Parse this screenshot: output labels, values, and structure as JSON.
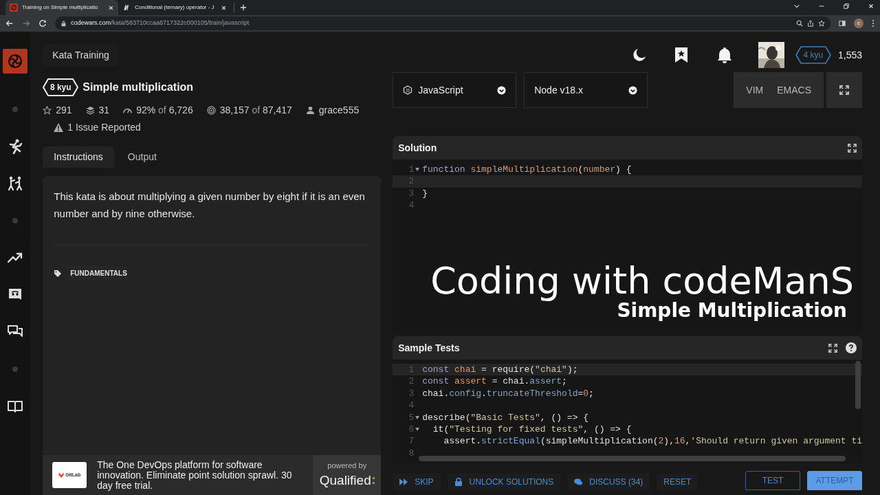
{
  "browser": {
    "tabs": [
      {
        "title": "Training on Simple multiplicatio",
        "selected": true,
        "kind": "codewars"
      },
      {
        "title": "Conditional (ternary) operator - J",
        "selected": false,
        "kind": "mdn"
      }
    ],
    "url_host": "codewars.com",
    "url_path": "/kata/583710ccaa6717322c000105/train/javascript",
    "profile_letter": "c"
  },
  "header": {
    "section": "Kata Training",
    "rank": "4 kyu",
    "honor": "1,553"
  },
  "kata": {
    "rank": "8 kyu",
    "title": "Simple multiplication",
    "stats": [
      {
        "kind": "star",
        "value": "291"
      },
      {
        "kind": "collections",
        "value": "31"
      },
      {
        "kind": "satisfaction",
        "value": "92%",
        "of": "of",
        "total": "6,726"
      },
      {
        "kind": "completed",
        "value": "38,157",
        "of": "of",
        "total": "87,417"
      },
      {
        "kind": "author",
        "value": "grace555"
      }
    ],
    "issues": "1 Issue Reported",
    "tabs": [
      {
        "label": "Instructions",
        "selected": true
      },
      {
        "label": "Output",
        "selected": false
      }
    ],
    "description": "This kata is about multiplying a given number by eight if it is an even number and by nine otherwise.",
    "tags": [
      "FUNDAMENTALS"
    ]
  },
  "ad": {
    "brand": "GitLab",
    "text": "The One DevOps platform for software innovation. Eliminate point solution sprawl. 30 day free trial.",
    "powered_by": "powered by",
    "platform": "Qualified"
  },
  "editor": {
    "language": "JavaScript",
    "runtime": "Node v18.x",
    "modes": [
      "VIM",
      "EMACS"
    ],
    "solution": {
      "title": "Solution",
      "lines": [
        {
          "number": "1",
          "fold": true,
          "tokens": [
            {
              "text": "function ",
              "kind": "kw"
            },
            {
              "text": "simpleMultiplication",
              "kind": "fn"
            },
            {
              "text": "(",
              "kind": "p"
            },
            {
              "text": "number",
              "kind": "fn"
            },
            {
              "text": ") {",
              "kind": "p"
            }
          ]
        },
        {
          "number": "2",
          "fold": false,
          "current": true
        },
        {
          "number": "3",
          "fold": false,
          "tokens": [
            {
              "text": "}",
              "kind": "p"
            }
          ]
        },
        {
          "number": "4",
          "fold": false
        }
      ]
    },
    "tests": {
      "title": "Sample Tests",
      "lines": [
        {
          "number": "1",
          "fold": false,
          "current": true,
          "tokens": [
            {
              "text": "const ",
              "kind": "kw"
            },
            {
              "text": "chai",
              "kind": "fn"
            },
            {
              "text": " = require(",
              "kind": "p"
            },
            {
              "text": "\"chai\"",
              "kind": "s"
            },
            {
              "text": ");",
              "kind": "p"
            }
          ]
        },
        {
          "number": "2",
          "fold": false,
          "tokens": [
            {
              "text": "const ",
              "kind": "kw"
            },
            {
              "text": "assert",
              "kind": "fn"
            },
            {
              "text": " = chai.",
              "kind": "p"
            },
            {
              "text": "assert",
              "kind": "prop"
            },
            {
              "text": ";",
              "kind": "p"
            }
          ]
        },
        {
          "number": "3",
          "fold": false,
          "tokens": [
            {
              "text": "chai.",
              "kind": "p"
            },
            {
              "text": "config",
              "kind": "prop"
            },
            {
              "text": ".",
              "kind": "p"
            },
            {
              "text": "truncateThreshold",
              "kind": "prop"
            },
            {
              "text": "=",
              "kind": "p"
            },
            {
              "text": "0",
              "kind": "n"
            },
            {
              "text": ";",
              "kind": "p"
            }
          ]
        },
        {
          "number": "4",
          "fold": false
        },
        {
          "number": "5",
          "fold": true,
          "tokens": [
            {
              "text": "describe(",
              "kind": "p"
            },
            {
              "text": "\"Basic Tests\"",
              "kind": "s"
            },
            {
              "text": ", () => {",
              "kind": "p"
            }
          ]
        },
        {
          "number": "6",
          "fold": true,
          "tokens": [
            {
              "text": "  it(",
              "kind": "p"
            },
            {
              "text": "\"Testing for fixed tests\"",
              "kind": "s"
            },
            {
              "text": ", () => {",
              "kind": "p"
            }
          ]
        },
        {
          "number": "7",
          "fold": false,
          "tokens": [
            {
              "text": "    assert.",
              "kind": "p"
            },
            {
              "text": "strictEqual",
              "kind": "prop"
            },
            {
              "text": "(simpleMultiplication(",
              "kind": "p"
            },
            {
              "text": "2",
              "kind": "n"
            },
            {
              "text": "),",
              "kind": "p"
            },
            {
              "text": "16",
              "kind": "n"
            },
            {
              "text": ",",
              "kind": "p"
            },
            {
              "text": "'Should return given argument ti",
              "kind": "s"
            }
          ]
        },
        {
          "number": "8",
          "fold": false
        }
      ]
    },
    "actions": [
      {
        "label": "SKIP",
        "kind": "skip"
      },
      {
        "label": "UNLOCK SOLUTIONS",
        "kind": "lock"
      },
      {
        "label": "DISCUSS (34)",
        "kind": "discuss"
      },
      {
        "label": "RESET",
        "kind": "plain"
      }
    ],
    "submit": [
      {
        "label": "TEST",
        "kind": "outline"
      },
      {
        "label": "ATTEMPT",
        "kind": "primary"
      }
    ]
  },
  "overlay": {
    "title": "Coding with codeManS",
    "subtitle": "Simple Multiplication"
  }
}
